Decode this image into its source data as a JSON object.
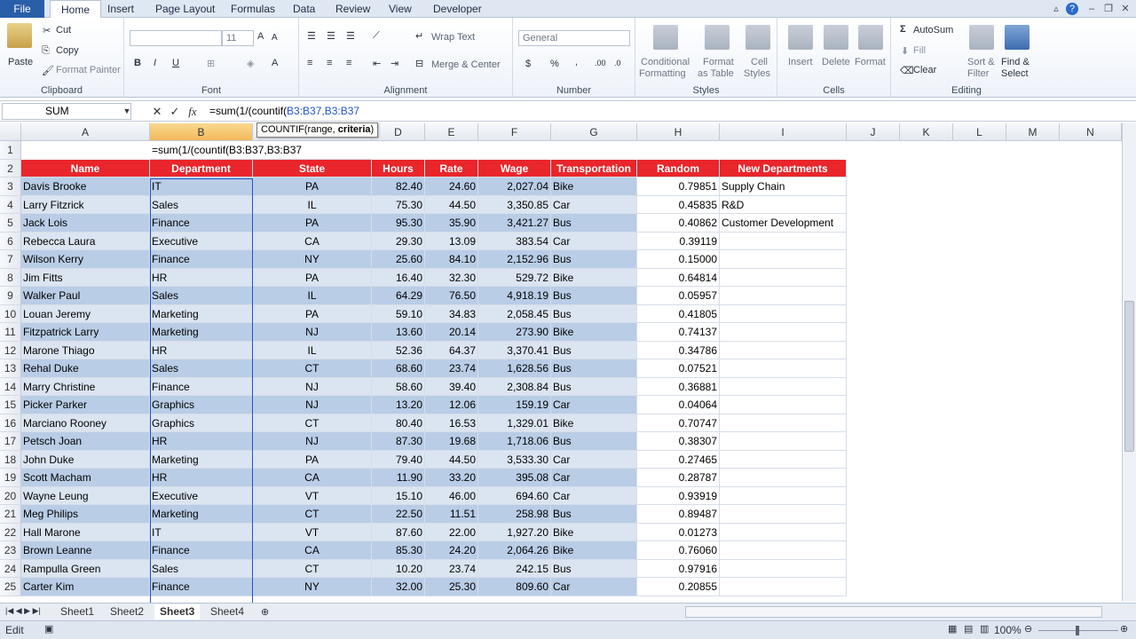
{
  "menu": {
    "file": "File",
    "tabs": [
      "Home",
      "Insert",
      "Page Layout",
      "Formulas",
      "Data",
      "Review",
      "View",
      "Developer"
    ]
  },
  "ribbon": {
    "clipboard": {
      "paste": "Paste",
      "cut": "Cut",
      "copy": "Copy",
      "format_painter": "Format Painter",
      "label": "Clipboard"
    },
    "font": {
      "size": "11",
      "label": "Font",
      "bold": "B",
      "italic": "I",
      "underline": "U"
    },
    "alignment": {
      "wrap_text": "Wrap Text",
      "merge_center": "Merge & Center",
      "label": "Alignment"
    },
    "number": {
      "format": "General",
      "currency": "$",
      "percent": "%",
      "comma": ",",
      "label": "Number"
    },
    "styles": {
      "conditional": "Conditional",
      "formatting": "Formatting",
      "format": "Format",
      "as_table": "as Table",
      "cell": "Cell",
      "styles_lbl": "Styles",
      "label": "Styles"
    },
    "cells": {
      "insert": "Insert",
      "delete": "Delete",
      "format": "Format",
      "label": "Cells"
    },
    "editing": {
      "autosum": "AutoSum",
      "fill": "Fill",
      "clear": "Clear",
      "sort": "Sort &",
      "filter": "Filter",
      "find": "Find &",
      "select": "Select",
      "label": "Editing"
    }
  },
  "formula_bar": {
    "name_box": "SUM",
    "formula_prefix": "=sum(1/(countif(",
    "formula_args": "B3:B37,B3:B37",
    "tooltip_fn": "COUNTIF(range, ",
    "tooltip_arg": "criteria",
    "tooltip_end": ")"
  },
  "columns": [
    "A",
    "B",
    "C",
    "D",
    "E",
    "F",
    "G",
    "H",
    "I",
    "J",
    "K",
    "L",
    "M",
    "N"
  ],
  "cell_b1": "=sum(1/(countif(B3:B37,B3:B37",
  "headers": [
    "Name",
    "Department",
    "State",
    "Hours",
    "Rate",
    "Wage",
    "Transportation",
    "Random",
    "New Departments"
  ],
  "rows": [
    {
      "r": "3",
      "name": "Davis Brooke",
      "dept": "IT",
      "state": "PA",
      "hours": "82.40",
      "rate": "24.60",
      "wage": "2,027.04",
      "trans": "Bike",
      "random": "0.79851",
      "newdept": "Supply Chain"
    },
    {
      "r": "4",
      "name": "Larry Fitzrick",
      "dept": "Sales",
      "state": "IL",
      "hours": "75.30",
      "rate": "44.50",
      "wage": "3,350.85",
      "trans": "Car",
      "random": "0.45835",
      "newdept": "R&D"
    },
    {
      "r": "5",
      "name": "Jack Lois",
      "dept": "Finance",
      "state": "PA",
      "hours": "95.30",
      "rate": "35.90",
      "wage": "3,421.27",
      "trans": "Bus",
      "random": "0.40862",
      "newdept": "Customer Development"
    },
    {
      "r": "6",
      "name": "Rebecca Laura",
      "dept": "Executive",
      "state": "CA",
      "hours": "29.30",
      "rate": "13.09",
      "wage": "383.54",
      "trans": "Car",
      "random": "0.39119",
      "newdept": ""
    },
    {
      "r": "7",
      "name": "Wilson Kerry",
      "dept": "Finance",
      "state": "NY",
      "hours": "25.60",
      "rate": "84.10",
      "wage": "2,152.96",
      "trans": "Bus",
      "random": "0.15000",
      "newdept": ""
    },
    {
      "r": "8",
      "name": "Jim Fitts",
      "dept": "HR",
      "state": "PA",
      "hours": "16.40",
      "rate": "32.30",
      "wage": "529.72",
      "trans": "Bike",
      "random": "0.64814",
      "newdept": ""
    },
    {
      "r": "9",
      "name": "Walker Paul",
      "dept": "Sales",
      "state": "IL",
      "hours": "64.29",
      "rate": "76.50",
      "wage": "4,918.19",
      "trans": "Bus",
      "random": "0.05957",
      "newdept": ""
    },
    {
      "r": "10",
      "name": "Louan Jeremy",
      "dept": "Marketing",
      "state": "PA",
      "hours": "59.10",
      "rate": "34.83",
      "wage": "2,058.45",
      "trans": "Bus",
      "random": "0.41805",
      "newdept": ""
    },
    {
      "r": "11",
      "name": "Fitzpatrick Larry",
      "dept": "Marketing",
      "state": "NJ",
      "hours": "13.60",
      "rate": "20.14",
      "wage": "273.90",
      "trans": "Bike",
      "random": "0.74137",
      "newdept": ""
    },
    {
      "r": "12",
      "name": "Marone Thiago",
      "dept": "HR",
      "state": "IL",
      "hours": "52.36",
      "rate": "64.37",
      "wage": "3,370.41",
      "trans": "Bus",
      "random": "0.34786",
      "newdept": ""
    },
    {
      "r": "13",
      "name": "Rehal Duke",
      "dept": "Sales",
      "state": "CT",
      "hours": "68.60",
      "rate": "23.74",
      "wage": "1,628.56",
      "trans": "Bus",
      "random": "0.07521",
      "newdept": ""
    },
    {
      "r": "14",
      "name": "Marry Christine",
      "dept": "Finance",
      "state": "NJ",
      "hours": "58.60",
      "rate": "39.40",
      "wage": "2,308.84",
      "trans": "Bus",
      "random": "0.36881",
      "newdept": ""
    },
    {
      "r": "15",
      "name": "Picker Parker",
      "dept": "Graphics",
      "state": "NJ",
      "hours": "13.20",
      "rate": "12.06",
      "wage": "159.19",
      "trans": "Car",
      "random": "0.04064",
      "newdept": ""
    },
    {
      "r": "16",
      "name": "Marciano Rooney",
      "dept": "Graphics",
      "state": "CT",
      "hours": "80.40",
      "rate": "16.53",
      "wage": "1,329.01",
      "trans": "Bike",
      "random": "0.70747",
      "newdept": ""
    },
    {
      "r": "17",
      "name": "Petsch Joan",
      "dept": "HR",
      "state": "NJ",
      "hours": "87.30",
      "rate": "19.68",
      "wage": "1,718.06",
      "trans": "Bus",
      "random": "0.38307",
      "newdept": ""
    },
    {
      "r": "18",
      "name": "John Duke",
      "dept": "Marketing",
      "state": "PA",
      "hours": "79.40",
      "rate": "44.50",
      "wage": "3,533.30",
      "trans": "Car",
      "random": "0.27465",
      "newdept": ""
    },
    {
      "r": "19",
      "name": "Scott Macham",
      "dept": "HR",
      "state": "CA",
      "hours": "11.90",
      "rate": "33.20",
      "wage": "395.08",
      "trans": "Car",
      "random": "0.28787",
      "newdept": ""
    },
    {
      "r": "20",
      "name": "Wayne Leung",
      "dept": "Executive",
      "state": "VT",
      "hours": "15.10",
      "rate": "46.00",
      "wage": "694.60",
      "trans": "Car",
      "random": "0.93919",
      "newdept": ""
    },
    {
      "r": "21",
      "name": "Meg Philips",
      "dept": "Marketing",
      "state": "CT",
      "hours": "22.50",
      "rate": "11.51",
      "wage": "258.98",
      "trans": "Bus",
      "random": "0.89487",
      "newdept": ""
    },
    {
      "r": "22",
      "name": "Hall Marone",
      "dept": "IT",
      "state": "VT",
      "hours": "87.60",
      "rate": "22.00",
      "wage": "1,927.20",
      "trans": "Bike",
      "random": "0.01273",
      "newdept": ""
    },
    {
      "r": "23",
      "name": "Brown Leanne",
      "dept": "Finance",
      "state": "CA",
      "hours": "85.30",
      "rate": "24.20",
      "wage": "2,064.26",
      "trans": "Bike",
      "random": "0.76060",
      "newdept": ""
    },
    {
      "r": "24",
      "name": "Rampulla Green",
      "dept": "Sales",
      "state": "CT",
      "hours": "10.20",
      "rate": "23.74",
      "wage": "242.15",
      "trans": "Bus",
      "random": "0.97916",
      "newdept": ""
    },
    {
      "r": "25",
      "name": "Carter Kim",
      "dept": "Finance",
      "state": "NY",
      "hours": "32.00",
      "rate": "25.30",
      "wage": "809.60",
      "trans": "Car",
      "random": "0.20855",
      "newdept": ""
    }
  ],
  "sheets": [
    "Sheet1",
    "Sheet2",
    "Sheet3",
    "Sheet4"
  ],
  "active_sheet": "Sheet3",
  "status": {
    "mode": "Edit",
    "zoom": "100%"
  },
  "colors": {
    "header_red": "#e8262b",
    "band_dark": "#b9cde6",
    "band_light": "#dbe5f1",
    "select_blue": "#2255c8",
    "file_tab": "#2a5ea8"
  }
}
